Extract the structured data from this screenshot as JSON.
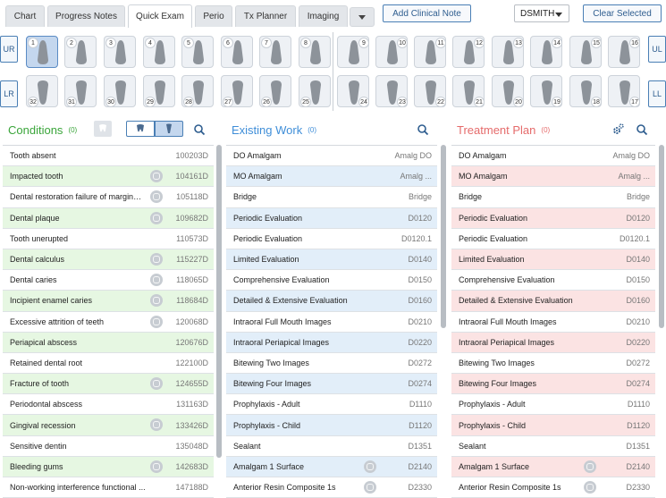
{
  "tabs": [
    {
      "label": "Chart",
      "active": false
    },
    {
      "label": "Progress Notes",
      "active": false
    },
    {
      "label": "Quick Exam",
      "active": true
    },
    {
      "label": "Perio",
      "active": false
    },
    {
      "label": "Tx Planner",
      "active": false
    },
    {
      "label": "Imaging",
      "active": false
    }
  ],
  "toolbar": {
    "add_note_label": "Add Clinical Note",
    "provider_value": "DSMITH",
    "clear_label": "Clear Selected"
  },
  "jaw_buttons": {
    "ur": "UR",
    "ul": "UL",
    "lr": "LR",
    "ll": "LL"
  },
  "teeth": {
    "upper": [
      "1",
      "2",
      "3",
      "4",
      "5",
      "6",
      "7",
      "8",
      "9",
      "10",
      "11",
      "12",
      "13",
      "14",
      "15",
      "16"
    ],
    "lower": [
      "32",
      "31",
      "30",
      "29",
      "28",
      "27",
      "26",
      "25",
      "24",
      "23",
      "22",
      "21",
      "20",
      "19",
      "18",
      "17"
    ],
    "selected": "1"
  },
  "conditions": {
    "title": "Conditions",
    "count": "(0)",
    "color": "#3aa53a",
    "rows": [
      {
        "name": "Tooth absent",
        "code": "100203D",
        "icon": false
      },
      {
        "name": "Impacted tooth",
        "code": "104161D",
        "icon": true
      },
      {
        "name": "Dental restoration failure of margina...",
        "code": "105118D",
        "icon": true
      },
      {
        "name": "Dental plaque",
        "code": "109682D",
        "icon": true
      },
      {
        "name": "Tooth unerupted",
        "code": "110573D",
        "icon": false
      },
      {
        "name": "Dental calculus",
        "code": "115227D",
        "icon": true
      },
      {
        "name": "Dental caries",
        "code": "118065D",
        "icon": true
      },
      {
        "name": "Incipient enamel caries",
        "code": "118684D",
        "icon": true
      },
      {
        "name": "Excessive attrition of teeth",
        "code": "120068D",
        "icon": true
      },
      {
        "name": "Periapical abscess",
        "code": "120676D",
        "icon": false
      },
      {
        "name": "Retained dental root",
        "code": "122100D",
        "icon": false
      },
      {
        "name": "Fracture of tooth",
        "code": "124655D",
        "icon": true
      },
      {
        "name": "Periodontal abscess",
        "code": "131163D",
        "icon": false
      },
      {
        "name": "Gingival recession",
        "code": "133426D",
        "icon": true
      },
      {
        "name": "Sensitive dentin",
        "code": "135048D",
        "icon": false
      },
      {
        "name": "Bleeding gums",
        "code": "142683D",
        "icon": true
      },
      {
        "name": "Non-working interference functional ...",
        "code": "147188D",
        "icon": false
      }
    ]
  },
  "existing": {
    "title": "Existing Work",
    "count": "(0)",
    "color": "#3f8ed8",
    "rows": [
      {
        "name": "DO Amalgam",
        "code": "Amalg DO",
        "icon": false
      },
      {
        "name": "MO Amalgam",
        "code": "Amalg ...",
        "icon": false
      },
      {
        "name": "Bridge",
        "code": "Bridge",
        "icon": false
      },
      {
        "name": "Periodic Evaluation",
        "code": "D0120",
        "icon": false
      },
      {
        "name": "Periodic Evaluation",
        "code": "D0120.1",
        "icon": false
      },
      {
        "name": "Limited Evaluation",
        "code": "D0140",
        "icon": false
      },
      {
        "name": "Comprehensive Evaluation",
        "code": "D0150",
        "icon": false
      },
      {
        "name": "Detailed & Extensive Evaluation",
        "code": "D0160",
        "icon": false
      },
      {
        "name": "Intraoral Full Mouth Images",
        "code": "D0210",
        "icon": false
      },
      {
        "name": "Intraoral Periapical Images",
        "code": "D0220",
        "icon": false
      },
      {
        "name": "Bitewing Two Images",
        "code": "D0272",
        "icon": false
      },
      {
        "name": "Bitewing Four Images",
        "code": "D0274",
        "icon": false
      },
      {
        "name": "Prophylaxis - Adult",
        "code": "D1110",
        "icon": false
      },
      {
        "name": "Prophylaxis - Child",
        "code": "D1120",
        "icon": false
      },
      {
        "name": "Sealant",
        "code": "D1351",
        "icon": false
      },
      {
        "name": "Amalgam 1 Surface",
        "code": "D2140",
        "icon": true
      },
      {
        "name": "Anterior Resin Composite 1s",
        "code": "D2330",
        "icon": true
      }
    ]
  },
  "treatment": {
    "title": "Treatment Plan",
    "count": "(0)",
    "color": "#e56b6b",
    "rows": [
      {
        "name": "DO Amalgam",
        "code": "Amalg DO",
        "icon": false
      },
      {
        "name": "MO Amalgam",
        "code": "Amalg ...",
        "icon": false
      },
      {
        "name": "Bridge",
        "code": "Bridge",
        "icon": false
      },
      {
        "name": "Periodic Evaluation",
        "code": "D0120",
        "icon": false
      },
      {
        "name": "Periodic Evaluation",
        "code": "D0120.1",
        "icon": false
      },
      {
        "name": "Limited Evaluation",
        "code": "D0140",
        "icon": false
      },
      {
        "name": "Comprehensive Evaluation",
        "code": "D0150",
        "icon": false
      },
      {
        "name": "Detailed & Extensive Evaluation",
        "code": "D0160",
        "icon": false
      },
      {
        "name": "Intraoral Full Mouth Images",
        "code": "D0210",
        "icon": false
      },
      {
        "name": "Intraoral Periapical Images",
        "code": "D0220",
        "icon": false
      },
      {
        "name": "Bitewing Two Images",
        "code": "D0272",
        "icon": false
      },
      {
        "name": "Bitewing Four Images",
        "code": "D0274",
        "icon": false
      },
      {
        "name": "Prophylaxis - Adult",
        "code": "D1110",
        "icon": false
      },
      {
        "name": "Prophylaxis - Child",
        "code": "D1120",
        "icon": false
      },
      {
        "name": "Sealant",
        "code": "D1351",
        "icon": false
      },
      {
        "name": "Amalgam 1 Surface",
        "code": "D2140",
        "icon": true
      },
      {
        "name": "Anterior Resin Composite 1s",
        "code": "D2330",
        "icon": true
      }
    ]
  },
  "colors": {
    "green_row": "#e6f7e2",
    "blue_row": "#e2eef9",
    "red_row": "#fbe3e3",
    "accent": "#4a7fb5"
  },
  "icons": {
    "condition_row": "tooth-marker-icon",
    "gear": "gear-icon",
    "search": "search-icon",
    "tooth_view": "tooth-icon"
  }
}
